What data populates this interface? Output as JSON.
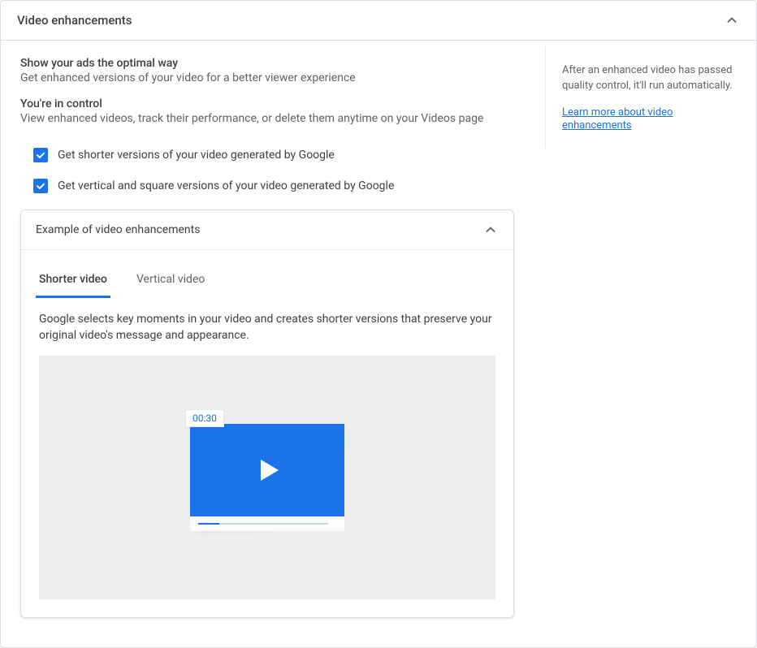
{
  "panel": {
    "title": "Video enhancements"
  },
  "sidebar": {
    "note": "After an enhanced video has passed quality control, it'll run automatically.",
    "link_text": "Learn more about video enhancements"
  },
  "sections": [
    {
      "title": "Show your ads the optimal way",
      "desc": "Get enhanced versions of your video for a better viewer experience"
    },
    {
      "title": "You're in control",
      "desc": "View enhanced videos, track their performance, or delete them anytime on your Videos page"
    }
  ],
  "options": [
    {
      "checked": true,
      "label": "Get shorter versions of your video generated by Google"
    },
    {
      "checked": true,
      "label": "Get vertical and square versions of your video generated by Google"
    }
  ],
  "example": {
    "title": "Example of video enhancements",
    "tabs": [
      {
        "label": "Shorter video",
        "active": true
      },
      {
        "label": "Vertical video",
        "active": false
      }
    ],
    "desc": "Google selects key moments in your video and creates shorter versions that preserve your original video's message and appearance.",
    "timestamp": "00:30"
  }
}
